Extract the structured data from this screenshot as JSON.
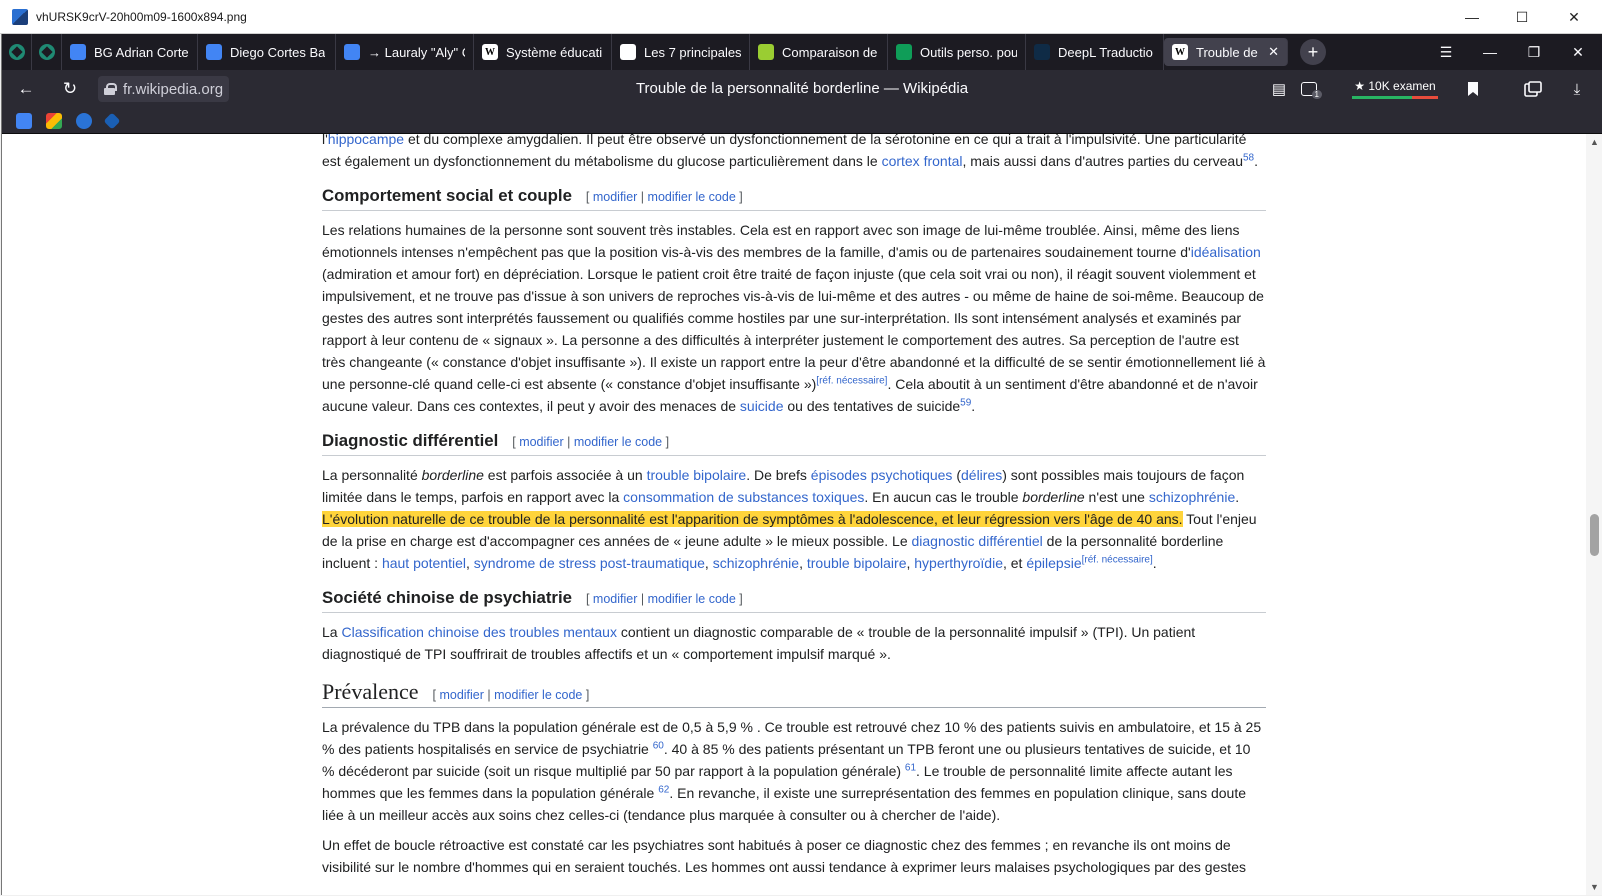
{
  "window": {
    "filename": "vhURSK9crV-20h00m09-1600x894.png",
    "minimize": "—",
    "maximize": "☐",
    "close": "✕"
  },
  "tabs": [
    {
      "label": "BG Adrian Corte",
      "icon": "google-docs-icon",
      "color": "#4285f4"
    },
    {
      "label": "Diego Cortes Ba",
      "icon": "google-docs-icon",
      "color": "#4285f4"
    },
    {
      "label": "→ Lauraly \"Aly\" C",
      "icon": "google-docs-icon",
      "color": "#4285f4"
    },
    {
      "label": "Système éducati",
      "icon": "wikipedia-icon",
      "color": "#ffffff"
    },
    {
      "label": "Les 7 principales",
      "icon": "pillars-icon",
      "color": "#ffffff"
    },
    {
      "label": "Comparaison de",
      "icon": "leaf-icon",
      "color": "#9acd32"
    },
    {
      "label": "Outils perso. pou",
      "icon": "google-sheets-icon",
      "color": "#0f9d58"
    },
    {
      "label": "DeepL Traductio",
      "icon": "deepl-icon",
      "color": "#0f2b46"
    },
    {
      "label": "Trouble de la p",
      "icon": "wikipedia-icon",
      "color": "#ffffff",
      "active": true
    }
  ],
  "tabbar": {
    "new_tab": "+",
    "list_all": "☰",
    "minimize": "—",
    "restore": "❐",
    "close": "✕",
    "tab_close": "✕"
  },
  "nav": {
    "back": "←",
    "reload": "↻",
    "url": "fr.wikipedia.org",
    "page_title": "Trouble de la personnalité borderline — Wikipédia",
    "reader_icon": "▤",
    "ext_badge": "1",
    "ext_label": "★ 10K examen",
    "bookmark": "⬛",
    "download": "⤓"
  },
  "article": {
    "intro": {
      "t1": "l'",
      "link1": "hippocampe",
      "t2": " et du complexe amygdalien. Il peut être observé un dysfonctionnement de la sérotonine en ce qui a trait à l'impulsivité. Une particularité est également un dysfonctionnement du métabolisme du glucose particulièrement dans le ",
      "link2": "cortex frontal",
      "t3": ", mais aussi dans d'autres parties du cerveau",
      "ref": "58",
      "end": "."
    },
    "edit": {
      "open": "[ ",
      "modifier": "modifier",
      "sep": " | ",
      "modifier_code": "modifier le code",
      "close": " ]"
    },
    "s1": {
      "title": "Comportement social et couple",
      "t1": "Les relations humaines de la personne sont souvent très instables. Cela est en rapport avec son image de lui-même troublée. Ainsi, même des liens émotionnels intenses n'empêchent pas que la position vis-à-vis des membres de la famille, d'amis ou de partenaires soudainement tourne d'",
      "link1": "idéalisation",
      "t2": " (admiration et amour fort) en dépréciation. Lorsque le patient croit être traité de façon injuste (que cela soit vrai ou non), il réagit souvent violemment et impulsivement, et ne trouve pas d'issue à son univers de reproches vis-à-vis de lui-même et des autres - ou même de haine de soi-même. Beaucoup de gestes des autres sont interprétés faussement ou qualifiés comme hostiles par une sur-interprétation. Ils sont intensément analysés et examinés par rapport à leur contenu de « signaux ». La personne a des difficultés à interpréter justement le comportement des autres. Sa perception de l'autre est très changeante (« constance d'objet insuffisante »). Il existe un rapport entre la peur d'être abandonné et la difficulté de se sentir émotionnellement lié à une personne-clé quand celle-ci est absente (« constance d'objet insuffisante »)",
      "refneeded": "[réf. nécessaire]",
      "t3": ". Cela aboutit à un sentiment d'être abandonné et de n'avoir aucune valeur. Dans ces contextes, il peut y avoir des menaces de ",
      "link2": "suicide",
      "t4": " ou des tentatives de suicide",
      "ref": "59",
      "end": "."
    },
    "s2": {
      "title": "Diagnostic différentiel",
      "t1": "La personnalité ",
      "em1": "borderline",
      "t2": " est parfois associée à un ",
      "link1": "trouble bipolaire",
      "t3": ". De brefs ",
      "link2": "épisodes psychotiques",
      "t4": " (",
      "link3": "délires",
      "t5": ") sont possibles mais toujours de façon limitée dans le temps, parfois en rapport avec la ",
      "link4": "consommation de substances toxiques",
      "t6": ". En aucun cas le trouble ",
      "em2": "borderline",
      "t7": " n'est une ",
      "link5": "schizophrénie",
      "t8": ". ",
      "highlight": "L'évolution naturelle de ce trouble de la personnalité est l'apparition de symptômes à l'adolescence, et leur régression vers l'âge de 40 ans.",
      "t9": " Tout l'enjeu de la prise en charge est d'accompagner ces années de « jeune adulte » le mieux possible. Le ",
      "link6": "diagnostic différentiel",
      "t10": " de la personnalité borderline incluent : ",
      "link7": "haut potentiel",
      "c1": ", ",
      "link8": "syndrome de stress post-traumatique",
      "c2": ", ",
      "link9": "schizophrénie",
      "c3": ", ",
      "link10": "trouble bipolaire",
      "c4": ", ",
      "link11": "hyperthyroïdie",
      "c5": ", et ",
      "link12": "épilepsie",
      "refneeded": "[réf. nécessaire]",
      "end": "."
    },
    "s3": {
      "title": "Société chinoise de psychiatrie",
      "t1": "La ",
      "link1": "Classification chinoise des troubles mentaux",
      "t2": " contient un diagnostic comparable de « trouble de la personnalité impulsif » (TPI). Un patient diagnostiqué de TPI souffrirait de troubles affectifs et un « comportement impulsif marqué »."
    },
    "s4": {
      "title": "Prévalence",
      "p1_t1": "La prévalence du TPB dans la population générale est de 0,5 à 5,9 % . Ce trouble est retrouvé chez 10 % des patients suivis en ambulatoire, et 15 à 25 % des patients hospitalisés en service de psychiatrie ",
      "ref1": "60",
      "p1_t2": ". 40 à 85 % des patients présentant un TPB feront une ou plusieurs tentatives de suicide, et 10 % décéderont par suicide (soit un risque multiplié par 50 par rapport à la population générale) ",
      "ref2": "61",
      "p1_t3": ". Le trouble de personnalité limite affecte autant les hommes que les femmes dans la population générale ",
      "ref3": "62",
      "p1_t4": ". En revanche, il existe une surreprésentation des femmes en population clinique, sans doute liée à un meilleur accès aux soins chez celles-ci (tendance plus marquée à consulter ou à chercher de l'aide).",
      "p2": "Un effet de boucle rétroactive est constaté car les psychiatres sont habitués à poser ce diagnostic chez des femmes ; en revanche ils ont moins de visibilité sur le nombre d'hommes qui en seraient touchés. Les hommes ont aussi tendance à exprimer leurs malaises psychologiques par des gestes"
    }
  },
  "scrollbar": {
    "up": "▲",
    "down": "▼"
  }
}
